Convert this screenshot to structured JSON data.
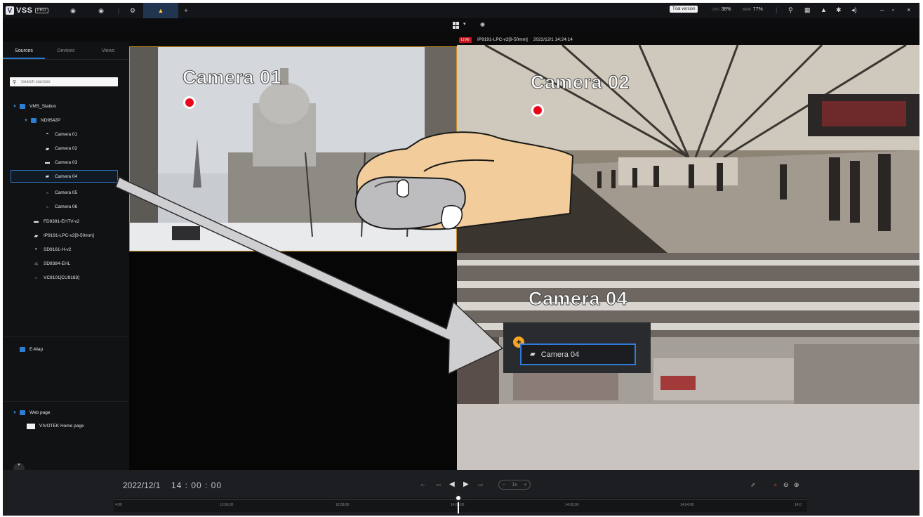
{
  "app": {
    "logo_text": "VSS",
    "logo_badge": "PRO",
    "trial_label": "Trial version",
    "cpu_label": "CPU",
    "cpu_value": "38%",
    "mem_label": "MEM",
    "mem_value": "77%"
  },
  "sidebar": {
    "tabs": [
      "Sources",
      "Devices",
      "Views"
    ],
    "search_placeholder": "Search sources",
    "tree": [
      {
        "label": "VMS_Station",
        "kind": "folder"
      },
      {
        "label": "ND9542P",
        "kind": "folder"
      },
      {
        "label": "Camera 01",
        "kind": "dome"
      },
      {
        "label": "Camera 02",
        "kind": "bullet"
      },
      {
        "label": "Camera 03",
        "kind": "box"
      },
      {
        "label": "Camera 04",
        "kind": "bullet"
      },
      {
        "label": "Camera 05",
        "kind": "offline"
      },
      {
        "label": "Camera 06",
        "kind": "offline"
      },
      {
        "label": "FD9391-EHTV-v2",
        "kind": "box"
      },
      {
        "label": "IP9191-LPC-v2[9-50mm]",
        "kind": "bullet"
      },
      {
        "label": "SD9161-H-v2",
        "kind": "dome"
      },
      {
        "label": "SD9384-EHL",
        "kind": "fisheye"
      },
      {
        "label": "VC9101[CU9183]",
        "kind": "offline"
      },
      {
        "label": "E-Map",
        "kind": "folder"
      },
      {
        "label": "Web page",
        "kind": "folder"
      },
      {
        "label": "VIVOTEK Home page",
        "kind": "page"
      }
    ]
  },
  "live": {
    "badge": "LIVE",
    "device": "IP9191-LPC-v2[9-50mm]",
    "timestamp": "2022/12/1 14:24:14"
  },
  "views": {
    "view1_title": "Camera 01",
    "view2_title": "Camera 02",
    "view4_title": "Camera 04",
    "drop_label": "Camera 04"
  },
  "timeline": {
    "date": "2022/12/1",
    "time": "14 : 00 : 00",
    "speed": "1x",
    "ticks": [
      "4:00",
      "13:56:00",
      "13:58:00",
      "14:00:00",
      "14:02:00",
      "14:04:00",
      "14:0"
    ]
  },
  "colors": {
    "accent": "#2e78c9",
    "selected_view_border": "#c98f25",
    "live": "#c4161c",
    "record": "#e8071a",
    "add": "#f5a623"
  }
}
